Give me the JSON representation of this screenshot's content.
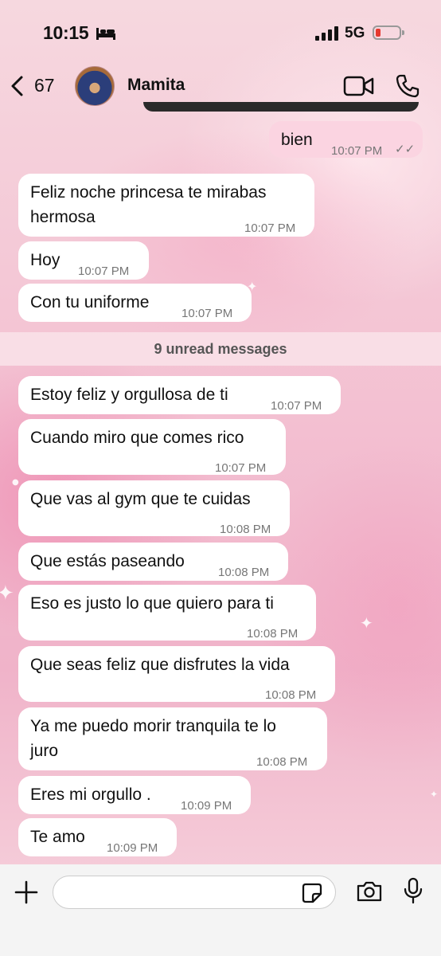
{
  "status_bar": {
    "time": "10:15",
    "network": "5G",
    "battery_color": "#e5392f"
  },
  "header": {
    "back_count": "67",
    "contact_name": "Mamita"
  },
  "messages": [
    {
      "direction": "out",
      "lines": [
        "bien"
      ],
      "time": "10:07 PM",
      "read": true
    },
    {
      "direction": "in",
      "lines": [
        "Feliz noche princesa te mirabas",
        "hermosa"
      ],
      "time": "10:07 PM"
    },
    {
      "direction": "in",
      "lines": [
        "Hoy"
      ],
      "time": "10:07 PM"
    },
    {
      "direction": "in",
      "lines": [
        "Con tu uniforme"
      ],
      "time": "10:07 PM"
    },
    {
      "direction": "in",
      "lines": [
        "Estoy feliz y orgullosa de ti"
      ],
      "time": "10:07 PM"
    },
    {
      "direction": "in",
      "lines": [
        "Cuando miro que comes rico"
      ],
      "time": "10:07 PM"
    },
    {
      "direction": "in",
      "lines": [
        "Que vas al gym que te cuidas"
      ],
      "time": "10:08 PM"
    },
    {
      "direction": "in",
      "lines": [
        "Que estás paseando"
      ],
      "time": "10:08 PM"
    },
    {
      "direction": "in",
      "lines": [
        "Eso es justo lo que quiero para ti"
      ],
      "time": "10:08 PM"
    },
    {
      "direction": "in",
      "lines": [
        "Que seas feliz que disfrutes la vida"
      ],
      "time": "10:08 PM"
    },
    {
      "direction": "in",
      "lines": [
        "Ya me puedo morir tranquila te lo",
        "juro"
      ],
      "time": "10:08 PM"
    },
    {
      "direction": "in",
      "lines": [
        "Eres mi orgullo ."
      ],
      "time": "10:09 PM"
    },
    {
      "direction": "in",
      "lines": [
        "Te amo"
      ],
      "time": "10:09 PM"
    }
  ],
  "unread_banner": "9 unread messages",
  "input": {
    "placeholder": ""
  },
  "icons": [
    "back-chevron-icon",
    "video-call-icon",
    "phone-call-icon",
    "plus-icon",
    "sticker-icon",
    "camera-icon",
    "microphone-icon",
    "read-receipt-icon",
    "sleep-focus-icon",
    "signal-icon",
    "battery-icon"
  ],
  "colors": {
    "outgoing_bubble": "#fbd4e1",
    "incoming_bubble": "#ffffff",
    "wallpaper": "#f3bfd1"
  }
}
